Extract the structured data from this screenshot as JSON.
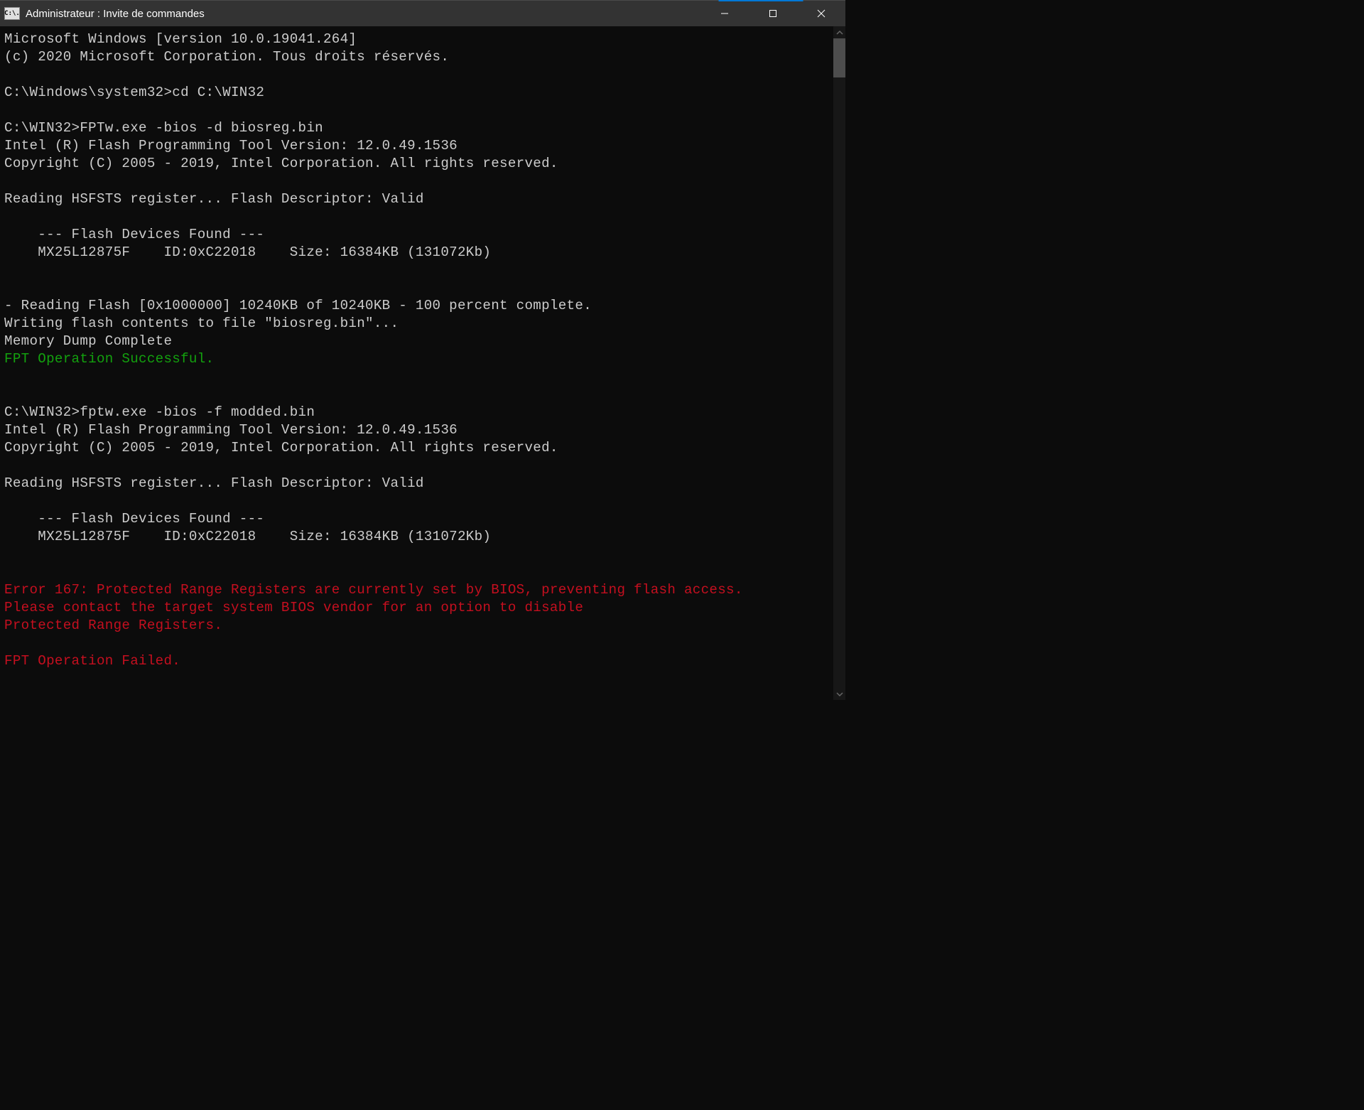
{
  "titlebar": {
    "icon_label": "C:\\.",
    "title": "Administrateur : Invite de commandes"
  },
  "terminal": {
    "lines": [
      {
        "text": "Microsoft Windows [version 10.0.19041.264]",
        "class": ""
      },
      {
        "text": "(c) 2020 Microsoft Corporation. Tous droits réservés.",
        "class": ""
      },
      {
        "text": "",
        "class": ""
      },
      {
        "text": "C:\\Windows\\system32>cd C:\\WIN32",
        "class": ""
      },
      {
        "text": "",
        "class": ""
      },
      {
        "text": "C:\\WIN32>FPTw.exe -bios -d biosreg.bin",
        "class": ""
      },
      {
        "text": "Intel (R) Flash Programming Tool Version: 12.0.49.1536",
        "class": ""
      },
      {
        "text": "Copyright (C) 2005 - 2019, Intel Corporation. All rights reserved.",
        "class": ""
      },
      {
        "text": "",
        "class": ""
      },
      {
        "text": "Reading HSFSTS register... Flash Descriptor: Valid",
        "class": ""
      },
      {
        "text": "",
        "class": ""
      },
      {
        "text": "    --- Flash Devices Found ---",
        "class": ""
      },
      {
        "text": "    MX25L12875F    ID:0xC22018    Size: 16384KB (131072Kb)",
        "class": ""
      },
      {
        "text": "",
        "class": ""
      },
      {
        "text": "",
        "class": ""
      },
      {
        "text": "- Reading Flash [0x1000000] 10240KB of 10240KB - 100 percent complete.",
        "class": ""
      },
      {
        "text": "Writing flash contents to file \"biosreg.bin\"...",
        "class": ""
      },
      {
        "text": "Memory Dump Complete",
        "class": ""
      },
      {
        "text": "FPT Operation Successful.",
        "class": "green"
      },
      {
        "text": "",
        "class": ""
      },
      {
        "text": "",
        "class": ""
      },
      {
        "text": "C:\\WIN32>fptw.exe -bios -f modded.bin",
        "class": ""
      },
      {
        "text": "Intel (R) Flash Programming Tool Version: 12.0.49.1536",
        "class": ""
      },
      {
        "text": "Copyright (C) 2005 - 2019, Intel Corporation. All rights reserved.",
        "class": ""
      },
      {
        "text": "",
        "class": ""
      },
      {
        "text": "Reading HSFSTS register... Flash Descriptor: Valid",
        "class": ""
      },
      {
        "text": "",
        "class": ""
      },
      {
        "text": "    --- Flash Devices Found ---",
        "class": ""
      },
      {
        "text": "    MX25L12875F    ID:0xC22018    Size: 16384KB (131072Kb)",
        "class": ""
      },
      {
        "text": "",
        "class": ""
      },
      {
        "text": "",
        "class": ""
      },
      {
        "text": "Error 167: Protected Range Registers are currently set by BIOS, preventing flash access.",
        "class": "red"
      },
      {
        "text": "Please contact the target system BIOS vendor for an option to disable",
        "class": "red"
      },
      {
        "text": "Protected Range Registers.",
        "class": "red"
      },
      {
        "text": "",
        "class": ""
      },
      {
        "text": "FPT Operation Failed.",
        "class": "red"
      }
    ]
  }
}
